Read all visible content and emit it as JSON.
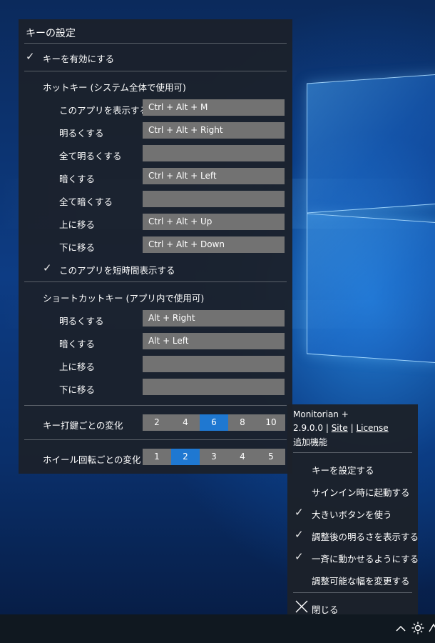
{
  "keys_panel": {
    "title": "キーの設定",
    "enable_keys_label": "キーを有効にする",
    "hotkeys_header": "ホットキー (システム全体で使用可)",
    "hotkeys": [
      {
        "label": "このアプリを表示する",
        "value": "Ctrl + Alt + M"
      },
      {
        "label": "明るくする",
        "value": "Ctrl + Alt + Right"
      },
      {
        "label": "全て明るくする",
        "value": ""
      },
      {
        "label": "暗くする",
        "value": "Ctrl + Alt + Left"
      },
      {
        "label": "全て暗くする",
        "value": ""
      },
      {
        "label": "上に移る",
        "value": "Ctrl + Alt + Up"
      },
      {
        "label": "下に移る",
        "value": "Ctrl + Alt + Down"
      }
    ],
    "show_briefly_label": "このアプリを短時間表示する",
    "shortcuts_header": "ショートカットキー (アプリ内で使用可)",
    "shortcuts": [
      {
        "label": "明るくする",
        "value": "Alt + Right"
      },
      {
        "label": "暗くする",
        "value": "Alt + Left"
      },
      {
        "label": "上に移る",
        "value": ""
      },
      {
        "label": "下に移る",
        "value": ""
      }
    ],
    "keystroke_change": {
      "label": "キー打鍵ごとの変化",
      "options": [
        "2",
        "4",
        "6",
        "8",
        "10"
      ],
      "selected": "6"
    },
    "wheel_change": {
      "label": "ホイール回転ごとの変化",
      "options": [
        "1",
        "2",
        "3",
        "4",
        "5"
      ],
      "selected": "2"
    }
  },
  "tray_menu": {
    "app_name": "Monitorian +",
    "version": "2.9.0.0",
    "separator": "|",
    "site_link": "Site",
    "license_link": "License",
    "addon_label": "追加機能",
    "items": [
      {
        "label": "キーを設定する",
        "checked": false
      },
      {
        "label": "サインイン時に起動する",
        "checked": false
      },
      {
        "label": "大きいボタンを使う",
        "checked": true
      },
      {
        "label": "調整後の明るさを表示する",
        "checked": true
      },
      {
        "label": "一斉に動かせるようにする",
        "checked": true
      },
      {
        "label": "調整可能な幅を変更する",
        "checked": false
      }
    ],
    "close_label": "閉じる"
  },
  "taskbar": {
    "icons": [
      "chevron-up-icon",
      "brightness-icon",
      "network-icon"
    ]
  },
  "colors": {
    "selected_segment": "#1f78d1",
    "field_bg": "#727272",
    "panel_bg": "#1c212a"
  }
}
